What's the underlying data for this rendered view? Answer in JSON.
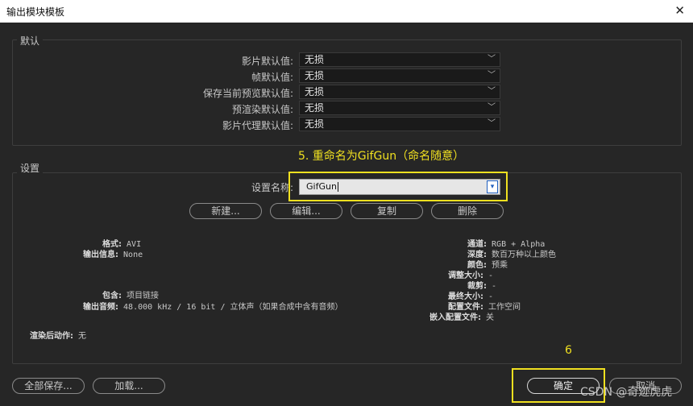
{
  "window": {
    "title": "输出模块模板",
    "close": "✕"
  },
  "defaults": {
    "group_label": "默认",
    "rows": [
      {
        "label": "影片默认值:",
        "value": "无损"
      },
      {
        "label": "帧默认值:",
        "value": "无损"
      },
      {
        "label": "保存当前预览默认值:",
        "value": "无损"
      },
      {
        "label": "预渲染默认值:",
        "value": "无损"
      },
      {
        "label": "影片代理默认值:",
        "value": "无损"
      }
    ]
  },
  "settings": {
    "group_label": "设置",
    "name_label": "设置名称:",
    "name_value": "GifGun",
    "buttons": {
      "new": "新建...",
      "edit": "编辑...",
      "copy": "复制",
      "delete": "删除"
    },
    "left_info": {
      "format_key": "格式:",
      "format_val": "AVI",
      "output_info_key": "输出信息:",
      "output_info_val": "None",
      "include_key": "包含:",
      "include_val": "项目链接",
      "audio_key": "输出音频:",
      "audio_val": "48.000 kHz / 16 bit / 立体声（如果合成中含有音频）",
      "post_render_key": "渲染后动作:",
      "post_render_val": "无"
    },
    "right_info": {
      "channels_key": "通道:",
      "channels_val": "RGB + Alpha",
      "depth_key": "深度:",
      "depth_val": "数百万种以上颜色",
      "color_key": "颜色:",
      "color_val": "预乘",
      "resize_key": "调整大小:",
      "resize_val": "-",
      "crop_key": "裁剪:",
      "crop_val": "-",
      "final_size_key": "最终大小:",
      "final_size_val": "-",
      "profile_key": "配置文件:",
      "profile_val": "工作空间",
      "embed_profile_key": "嵌入配置文件:",
      "embed_profile_val": "关"
    }
  },
  "bottom": {
    "save_all": "全部保存...",
    "load": "加载...",
    "ok": "确定",
    "cancel": "取消"
  },
  "annotations": {
    "step5": "5. 重命名为GifGun（命名随意）",
    "step6": "6",
    "watermark": "CSDN @奇迹虎虎"
  },
  "colors": {
    "highlight": "#f0e020",
    "background": "#262626"
  }
}
